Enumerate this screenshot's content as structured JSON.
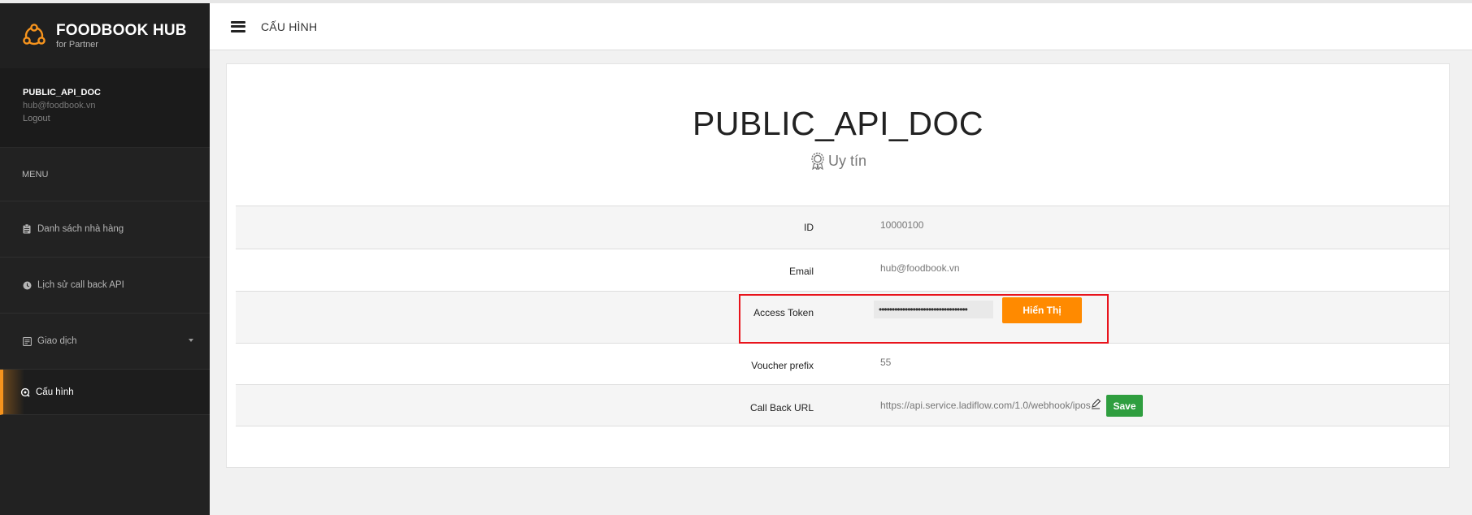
{
  "brand": {
    "title": "FOODBOOK HUB",
    "subtitle": "for Partner"
  },
  "profile": {
    "name": "PUBLIC_API_DOC",
    "email": "hub@foodbook.vn",
    "logout": "Logout"
  },
  "menu": {
    "header": "MENU",
    "items": [
      {
        "label": "Danh sách nhà hàng",
        "icon": "clipboard-icon"
      },
      {
        "label": "Lịch sử call back API",
        "icon": "clock-icon"
      },
      {
        "label": "Giao dịch",
        "icon": "transaction-icon",
        "has_dropdown": true
      },
      {
        "label": "Cấu hình",
        "icon": "config-icon",
        "active": true
      }
    ]
  },
  "topbar": {
    "title": "CẤU HÌNH"
  },
  "account": {
    "title": "PUBLIC_API_DOC",
    "badge": "Uy tín"
  },
  "fields": {
    "id": {
      "label": "ID",
      "value": "10000100"
    },
    "email": {
      "label": "Email",
      "value": "hub@foodbook.vn"
    },
    "token": {
      "label": "Access Token",
      "masked": "••••••••••••••••••••••••••••••••••",
      "button": "Hiển Thị"
    },
    "voucher": {
      "label": "Voucher prefix",
      "value": "55"
    },
    "callback": {
      "label": "Call Back URL",
      "value": "https://api.service.ladiflow.com/1.0/webhook/ipos",
      "button": "Save"
    }
  },
  "colors": {
    "accent": "#ff8a00",
    "save": "#2f9e3f",
    "highlight": "#e8141c",
    "sidebar": "#222222"
  }
}
